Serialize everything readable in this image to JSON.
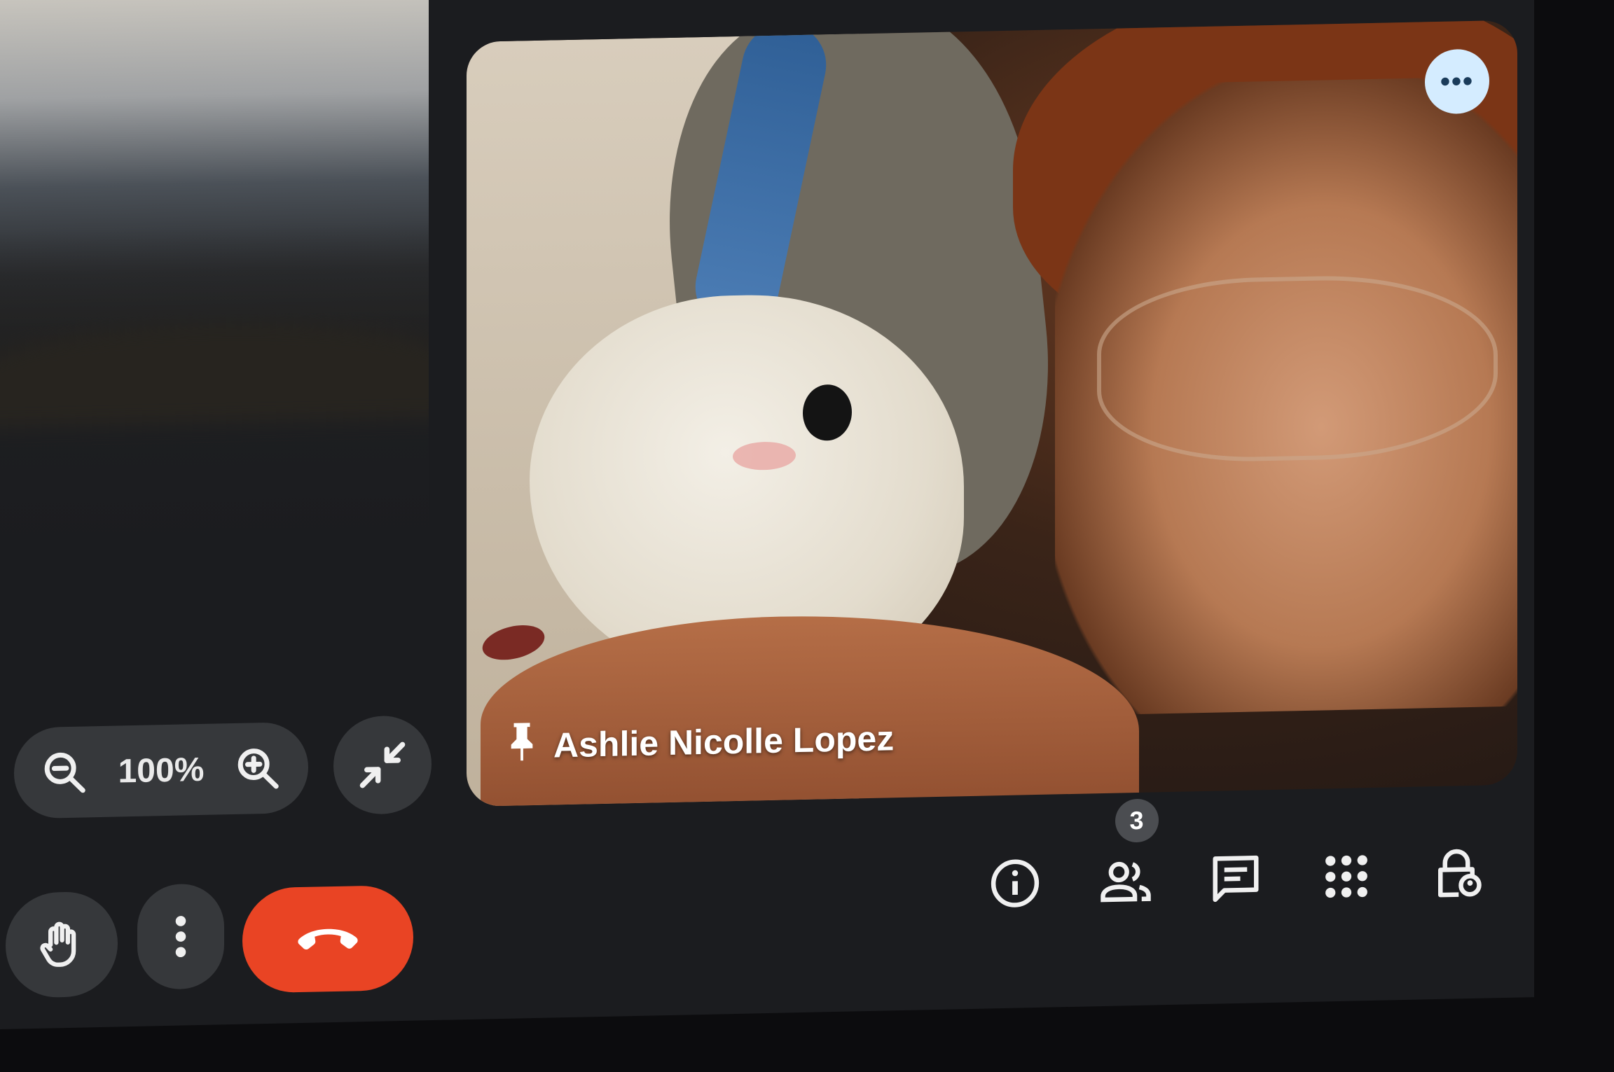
{
  "main_tile": {
    "participant_name": "Ashlie Nicolle Lopez",
    "more_options_label": "•••"
  },
  "zoom": {
    "level": "100%"
  },
  "toolbar": {
    "people_count": "3"
  },
  "icons": {
    "more": "more-options-icon",
    "pin": "pin-icon",
    "zoom_out": "zoom-out-icon",
    "zoom_in": "zoom-in-icon",
    "exit_fullscreen": "exit-fullscreen-icon",
    "raise_hand": "raise-hand-icon",
    "more_vert": "more-vert-icon",
    "hang_up": "hang-up-icon",
    "info": "info-icon",
    "people": "people-icon",
    "chat": "chat-icon",
    "activities": "apps-grid-icon",
    "host_controls": "lock-person-icon"
  },
  "colors": {
    "hangup": "#e94424",
    "more_button": "#d4ecff",
    "pill_bg": "#36383b",
    "badge": "#4b4d51"
  }
}
